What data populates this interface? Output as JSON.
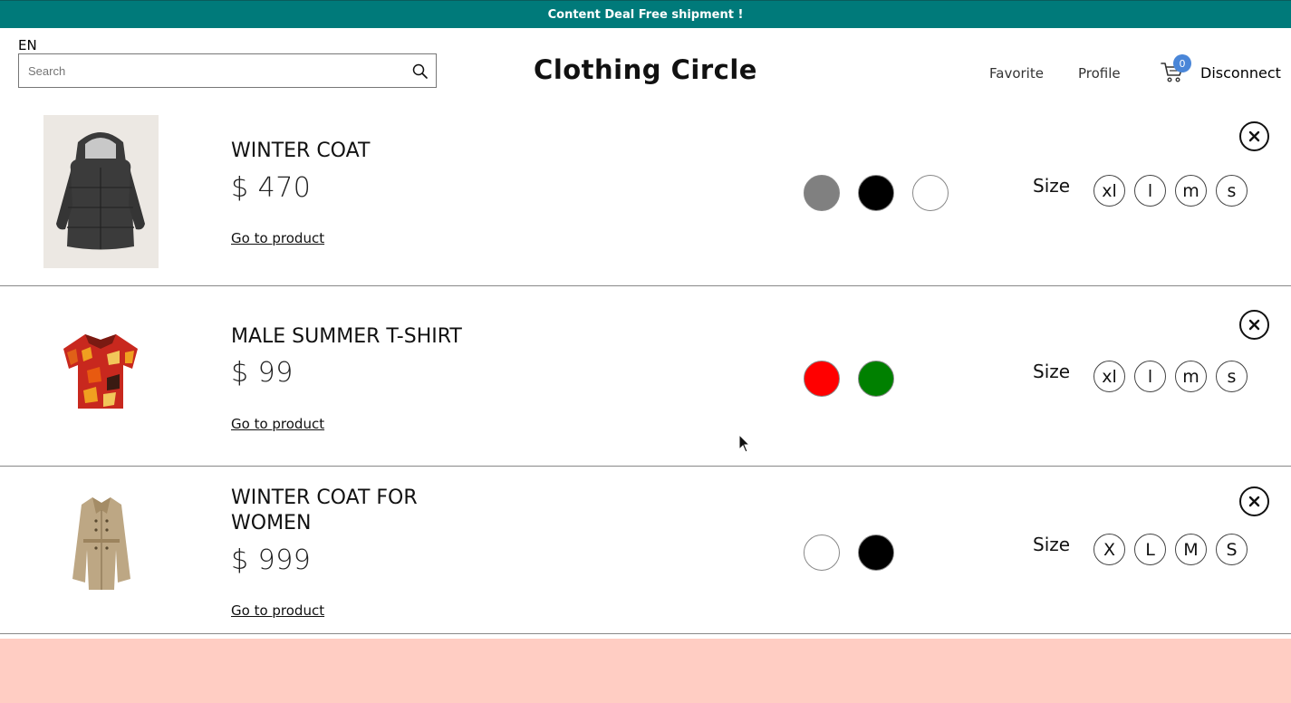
{
  "announcement": "Content Deal Free shipment !",
  "header": {
    "language": "EN",
    "search_placeholder": "Search",
    "search_icon": "search-icon",
    "brand": "Clothing Circle",
    "nav": {
      "favorite": "Favorite",
      "profile": "Profile",
      "disconnect": "Disconnect"
    },
    "cart": {
      "icon": "cart-icon",
      "count": "0"
    }
  },
  "cart_items": [
    {
      "name": "WINTER COAT",
      "price": "$ 470",
      "link": "Go to product",
      "colors": [
        "#808080",
        "#000000",
        "#ffffff"
      ],
      "size_label": "Size",
      "sizes": [
        "xl",
        "l",
        "m",
        "s"
      ]
    },
    {
      "name": "MALE SUMMER T-SHIRT",
      "price": "$ 99",
      "link": "Go to product",
      "colors": [
        "#ff0000",
        "#008000"
      ],
      "size_label": "Size",
      "sizes": [
        "xl",
        "l",
        "m",
        "s"
      ]
    },
    {
      "name": "WINTER COAT FOR WOMEN",
      "price": "$ 999",
      "link": "Go to product",
      "colors": [
        "#ffffff",
        "#000000"
      ],
      "size_label": "Size",
      "sizes": [
        "X",
        "L",
        "M",
        "S"
      ]
    }
  ],
  "colors": {
    "announcement_bg": "#007a7a",
    "badge": "#4a86d8",
    "footer_band": "#ffcdc3"
  }
}
